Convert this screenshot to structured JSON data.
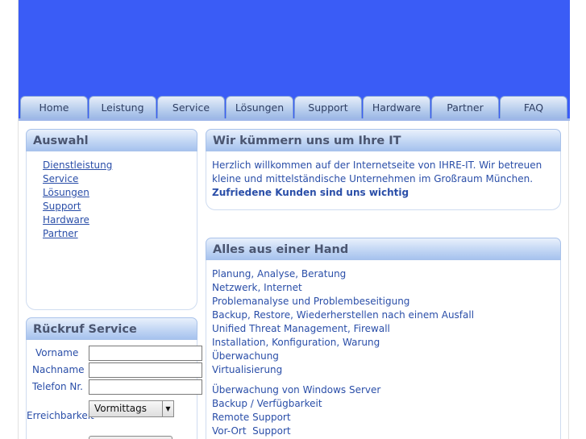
{
  "nav": {
    "tabs": [
      {
        "label": "Home"
      },
      {
        "label": "Leistung"
      },
      {
        "label": "Service"
      },
      {
        "label": "Lösungen"
      },
      {
        "label": "Support"
      },
      {
        "label": "Hardware"
      },
      {
        "label": "Partner"
      },
      {
        "label": "FAQ"
      }
    ]
  },
  "sidebar": {
    "title": "Auswahl",
    "links": [
      {
        "label": "Dienstleistung"
      },
      {
        "label": "Service"
      },
      {
        "label": "Lösungen"
      },
      {
        "label": "Support"
      },
      {
        "label": "Hardware"
      },
      {
        "label": "Partner"
      }
    ]
  },
  "callback": {
    "title": "Rückruf Service",
    "fields": [
      {
        "label": "Vorname",
        "value": ""
      },
      {
        "label": "Nachname",
        "value": ""
      },
      {
        "label": "Telefon Nr.",
        "value": ""
      }
    ],
    "availability_label": "Erreichbarkeit",
    "availability_selected": "Vormittags"
  },
  "welcome": {
    "title": "Wir kümmern uns um Ihre IT",
    "text": "Herzlich willkommen auf der Internetseite von IHRE-IT. Wir betreuen kleine und mittelständische Unternehmen im Großraum München.",
    "highlight": "Zufriedene Kunden sind uns wichtig"
  },
  "services": {
    "title": "Alles aus einer Hand",
    "items": [
      "Planung, Analyse, Beratung",
      "Netzwerk, Internet",
      "Problemanalyse und Problembeseitigung",
      "Backup, Restore, Wiederherstellen nach einem Ausfall",
      "Unified Threat Management, Firewall",
      "Installation, Konfiguration, Warung",
      "Überwachung",
      "Virtualisierung",
      "Überwachung von Windows Server",
      "Backup / Verfügbarkeit",
      "Remote Support",
      "Vor-Ort  Support"
    ]
  },
  "colors": {
    "banner": "#3a5cf6",
    "link": "#2a4ea8"
  }
}
